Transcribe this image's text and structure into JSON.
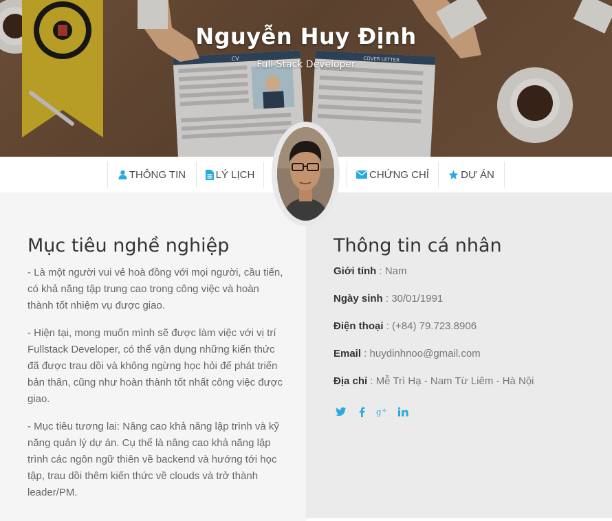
{
  "header": {
    "name": "Nguyễn Huy Định",
    "role": "Full Stack Developer",
    "paper_labels": {
      "cv": "CV",
      "cover_letter": "COVER LETTER"
    }
  },
  "nav": {
    "items": [
      {
        "label": "THÔNG TIN",
        "icon": "user-icon"
      },
      {
        "label": "LÝ LỊCH",
        "icon": "file-icon"
      },
      {
        "label": "CHỨNG CHỈ",
        "icon": "envelope-icon"
      },
      {
        "label": "DỰ ÁN",
        "icon": "star-icon"
      }
    ]
  },
  "objective": {
    "title": "Mục tiêu nghề nghiệp",
    "paragraphs": [
      "- Là một người vui vẻ hoà đồng với mọi người, cầu tiến, có khả năng tập trung cao trong công việc và hoàn thành tốt nhiệm vụ được giao.",
      "- Hiện tại, mong muốn mình sẽ được làm việc với vị trí Fullstack Developer, có thể vận dụng những kiến thức đã được trau dồi và không ngừng học hỏi để phát triển bản thân, cũng như hoàn thành tốt nhất công việc được giao.",
      "- Mục tiêu tương lai: Nâng cao khả năng lập trình và kỹ năng quản lý dự án. Cụ thể là nâng cao khả năng lập trình các ngôn ngữ thiên về backend và hướng tới học tập, trau dồi thêm kiến thức về clouds và trở thành leader/PM."
    ]
  },
  "personal": {
    "title": "Thông tin cá nhân",
    "rows": [
      {
        "label": "Giới tính",
        "value": " : Nam"
      },
      {
        "label": "Ngày sinh",
        "value": " : 30/01/1991"
      },
      {
        "label": "Điện thoại",
        "value": " : (+84) 79.723.8906"
      },
      {
        "label": "Email",
        "value": " : huydinhnoo@gmail.com"
      },
      {
        "label": "Địa chỉ",
        "value": " : Mễ Trì Hạ - Nam Từ Liêm - Hà Nội"
      }
    ],
    "socials": [
      "twitter-icon",
      "facebook-icon",
      "google-plus-icon",
      "linkedin-icon"
    ]
  },
  "colors": {
    "accent": "#29a9e1",
    "left_bg": "#f5f5f5",
    "right_bg": "#ebebeb"
  }
}
